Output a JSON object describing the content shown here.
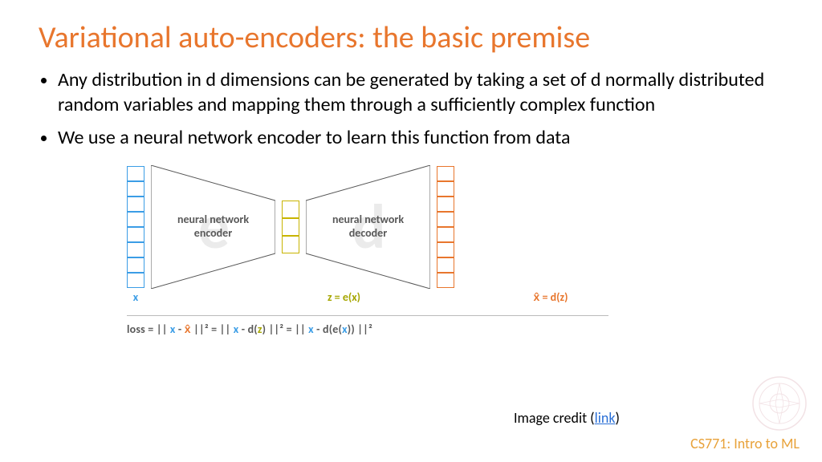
{
  "title": "Variational auto-encoders: the basic premise",
  "bullets": [
    "Any distribution in d dimensions can be generated by taking a set of d normally distributed random variables and mapping them through a sufficiently complex function",
    "We use a neural network encoder to learn this function from data"
  ],
  "diagram": {
    "input_cells": 8,
    "latent_cells": 3,
    "output_cells": 8,
    "encoder_bg_letter": "e",
    "encoder_label_line1": "neural network",
    "encoder_label_line2": "encoder",
    "decoder_bg_letter": "d",
    "decoder_label_line1": "neural network",
    "decoder_label_line2": "decoder",
    "x_label": "x",
    "z_label": "z = e(x)",
    "xhat_label": "x̂ = d(z)"
  },
  "loss": {
    "prefix": "loss   =   || ",
    "x1": "x",
    "m1": " - ",
    "xh1": "x̂",
    "s1": " ||²   =   || ",
    "x2": "x",
    "m2": " - d(",
    "z1": "z",
    "s2": ") ||²   =   || ",
    "x3": "x",
    "m3": " - d(e(",
    "x4": "x",
    "s3": ")) ||²"
  },
  "credit_prefix": "Image credit (",
  "credit_link": "link",
  "credit_suffix": ")",
  "footer": "CS771: Intro to ML"
}
